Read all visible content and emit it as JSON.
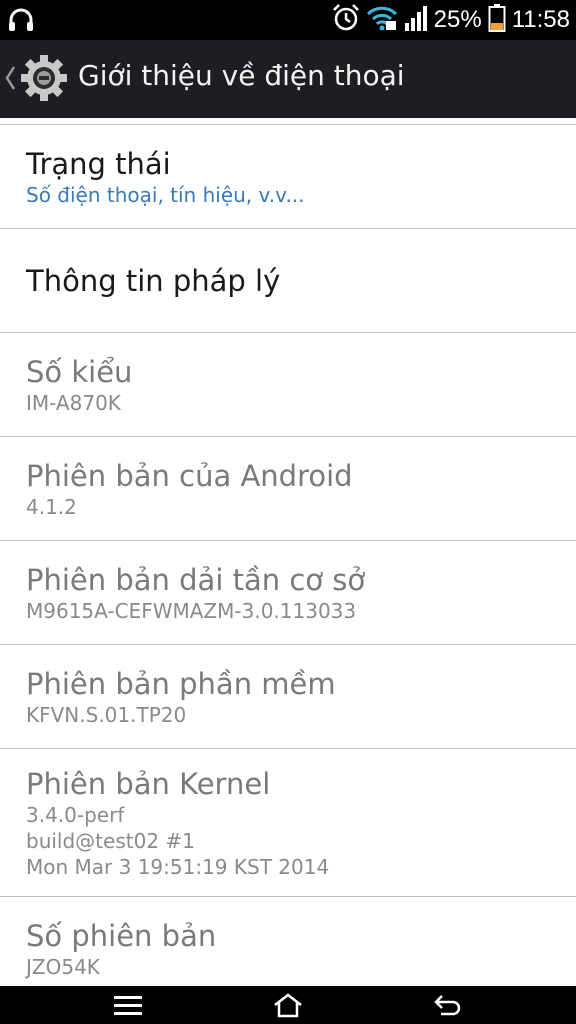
{
  "status_bar": {
    "battery_percent": "25%",
    "time": "11:58",
    "icons": [
      "headset-icon",
      "alarm-icon",
      "wifi-icon",
      "signal-icon",
      "battery-icon"
    ]
  },
  "action_bar": {
    "title": "Giới thiệu về điện thoại",
    "icon": "settings-gear-icon"
  },
  "items": [
    {
      "title": "Trạng thái",
      "subtitle": "Số điện thoại, tín hiệu, v.v..."
    },
    {
      "title": "Thông tin pháp lý"
    },
    {
      "title": "Số kiểu",
      "subtitle": "IM-A870K"
    },
    {
      "title": "Phiên bản của Android",
      "subtitle": "4.1.2"
    },
    {
      "title": "Phiên bản dải tần cơ sở",
      "subtitle": "M9615A-CEFWMAZM-3.0.113033"
    },
    {
      "title": "Phiên bản phần mềm",
      "subtitle": "KFVN.S.01.TP20"
    },
    {
      "title": "Phiên bản Kernel",
      "subtitle_lines": [
        "3.4.0-perf",
        "build@test02 #1",
        "Mon Mar 3 19:51:19 KST 2014"
      ]
    },
    {
      "title": "Số phiên bản",
      "subtitle": "JZO54K"
    }
  ],
  "nav_bar": {
    "icons": [
      "menu-icon",
      "home-icon",
      "back-icon"
    ]
  },
  "colors": {
    "action_bar_bg": "#1d1e21",
    "subtitle_blue": "#3a7ab8",
    "battery_orange": "#f0a030"
  }
}
